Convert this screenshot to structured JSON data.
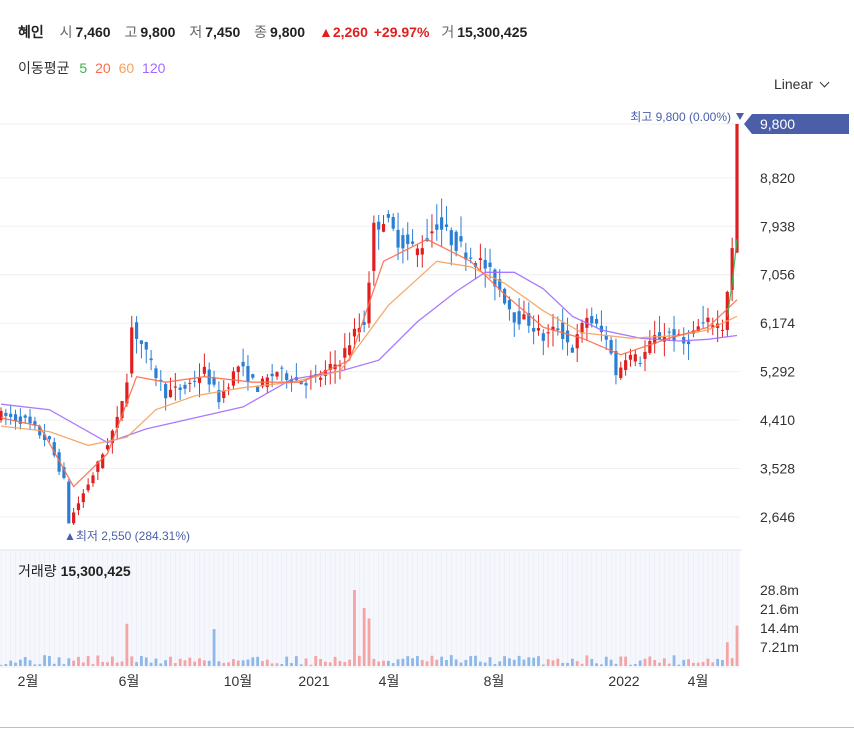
{
  "stock": {
    "name": "혜인",
    "open_label": "시",
    "open": "7,460",
    "high_label": "고",
    "high": "9,800",
    "low_label": "저",
    "low": "7,450",
    "close_label": "종",
    "close": "9,800",
    "change": "▲2,260",
    "change_pct": "+29.97%",
    "volume_label": "거",
    "volume": "15,300,425"
  },
  "ma": {
    "title": "이동평균",
    "ma5": "5",
    "ma20": "20",
    "ma60": "60",
    "ma120": "120"
  },
  "scale": {
    "label": "Linear"
  },
  "colors": {
    "up": "#e02020",
    "down": "#2a7fd4",
    "ma5": "#39b54a",
    "ma20": "#ff6b4a",
    "ma60": "#f5a25d",
    "ma120": "#a06bff",
    "last_price_bg": "#4a5fa8"
  },
  "annotations": {
    "high_text": "최고 9,800 (0.00%)",
    "low_text": "▲최저 2,550 (284.31%)",
    "last_price": "9,800"
  },
  "volume": {
    "title": "거래량",
    "value": "15,300,425"
  },
  "chart_data": {
    "type": "candlestick",
    "y_ticks": [
      "9,800",
      "8,820",
      "7,938",
      "7,056",
      "6,174",
      "5,292",
      "4,410",
      "3,528",
      "2,646"
    ],
    "y_tick_values": [
      9800,
      8820,
      7938,
      7056,
      6174,
      5292,
      4410,
      3528,
      2646
    ],
    "volume_ticks": [
      "28.8m",
      "21.6m",
      "14.4m",
      "7.21m"
    ],
    "volume_tick_values": [
      28.8,
      21.6,
      14.4,
      7.21
    ],
    "x_ticks": [
      "2월",
      "6월",
      "10월",
      "2021",
      "4월",
      "8월",
      "2022",
      "4월"
    ],
    "price_path": [
      [
        0,
        4500
      ],
      [
        5,
        4400
      ],
      [
        10,
        4000
      ],
      [
        13,
        3300
      ],
      [
        14,
        2550
      ],
      [
        16,
        2900
      ],
      [
        20,
        3600
      ],
      [
        24,
        4400
      ],
      [
        26,
        5200
      ],
      [
        27,
        6100
      ],
      [
        29,
        5800
      ],
      [
        31,
        5400
      ],
      [
        34,
        4900
      ],
      [
        38,
        5000
      ],
      [
        42,
        5300
      ],
      [
        45,
        4800
      ],
      [
        49,
        5400
      ],
      [
        53,
        5000
      ],
      [
        57,
        5300
      ],
      [
        62,
        5100
      ],
      [
        66,
        5200
      ],
      [
        70,
        5500
      ],
      [
        73,
        6000
      ],
      [
        75,
        6200
      ],
      [
        76,
        7000
      ],
      [
        77,
        7900
      ],
      [
        79,
        8100
      ],
      [
        82,
        7700
      ],
      [
        86,
        7500
      ],
      [
        90,
        8000
      ],
      [
        93,
        7700
      ],
      [
        97,
        7400
      ],
      [
        100,
        7200
      ],
      [
        103,
        6800
      ],
      [
        106,
        6300
      ],
      [
        109,
        6200
      ],
      [
        112,
        5900
      ],
      [
        115,
        6100
      ],
      [
        118,
        5700
      ],
      [
        121,
        6300
      ],
      [
        124,
        6000
      ],
      [
        126,
        5700
      ],
      [
        127,
        5200
      ],
      [
        129,
        5600
      ],
      [
        132,
        5500
      ],
      [
        135,
        5900
      ],
      [
        138,
        6000
      ],
      [
        141,
        5800
      ],
      [
        144,
        6100
      ],
      [
        147,
        6200
      ],
      [
        149,
        6100
      ],
      [
        150,
        6800
      ],
      [
        151,
        7500
      ],
      [
        152,
        9800
      ]
    ],
    "ma_paths": {
      "ma5": [
        [
          150,
          6300
        ],
        [
          151,
          6900
        ],
        [
          152,
          7700
        ]
      ],
      "ma20": [
        [
          0,
          4450
        ],
        [
          8,
          4300
        ],
        [
          15,
          3200
        ],
        [
          22,
          3800
        ],
        [
          28,
          5200
        ],
        [
          34,
          5100
        ],
        [
          42,
          5200
        ],
        [
          52,
          5100
        ],
        [
          62,
          5100
        ],
        [
          72,
          5500
        ],
        [
          79,
          7300
        ],
        [
          88,
          7700
        ],
        [
          97,
          7300
        ],
        [
          104,
          6700
        ],
        [
          112,
          6100
        ],
        [
          120,
          5900
        ],
        [
          128,
          5600
        ],
        [
          138,
          5900
        ],
        [
          146,
          6100
        ],
        [
          152,
          6600
        ]
      ],
      "ma60": [
        [
          0,
          4300
        ],
        [
          10,
          4200
        ],
        [
          18,
          3950
        ],
        [
          26,
          4100
        ],
        [
          32,
          4600
        ],
        [
          40,
          4850
        ],
        [
          50,
          5000
        ],
        [
          60,
          5100
        ],
        [
          70,
          5300
        ],
        [
          80,
          6500
        ],
        [
          90,
          7300
        ],
        [
          97,
          7200
        ],
        [
          104,
          6900
        ],
        [
          112,
          6400
        ],
        [
          120,
          6000
        ],
        [
          130,
          5900
        ],
        [
          140,
          5950
        ],
        [
          146,
          6050
        ],
        [
          152,
          6300
        ]
      ],
      "ma120": [
        [
          0,
          4700
        ],
        [
          10,
          4600
        ],
        [
          22,
          4000
        ],
        [
          30,
          4250
        ],
        [
          40,
          4450
        ],
        [
          50,
          4650
        ],
        [
          60,
          5150
        ],
        [
          70,
          5300
        ],
        [
          78,
          5500
        ],
        [
          86,
          6200
        ],
        [
          94,
          6750
        ],
        [
          100,
          7100
        ],
        [
          106,
          7100
        ],
        [
          112,
          6800
        ],
        [
          118,
          6300
        ],
        [
          124,
          6050
        ],
        [
          132,
          5900
        ],
        [
          140,
          5850
        ],
        [
          146,
          5880
        ],
        [
          152,
          5950
        ]
      ]
    },
    "volume_spikes": [
      [
        26,
        16
      ],
      [
        44,
        14
      ],
      [
        73,
        28.8
      ],
      [
        75,
        22
      ],
      [
        76,
        18
      ],
      [
        150,
        9
      ],
      [
        152,
        15.3
      ]
    ],
    "volume_base": 1.5
  }
}
